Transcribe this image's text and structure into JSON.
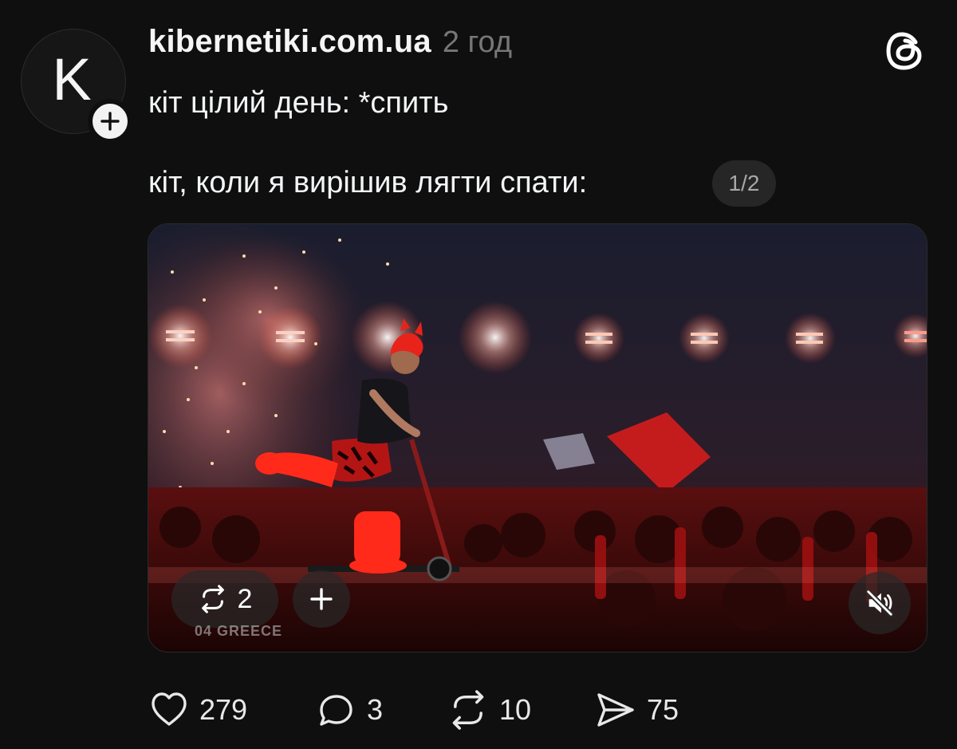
{
  "author": {
    "avatar_letter": "K",
    "username": "kibernetiki.com.ua",
    "time_ago": "2 год"
  },
  "post": {
    "line1": "кіт цілий день: *спить",
    "line2": "кіт, коли я вирішив лягти спати:",
    "page_indicator": "1/2"
  },
  "media": {
    "repost_count": "2",
    "watermark": "04 GREECE",
    "muted": true
  },
  "actions": {
    "likes": "279",
    "comments": "3",
    "reposts": "10",
    "shares": "75"
  },
  "icons": {
    "follow": "plus-icon",
    "app": "threads-logo-icon",
    "repost": "repost-icon",
    "add": "plus-icon",
    "mute": "speaker-muted-icon",
    "like": "heart-icon",
    "comment": "comment-icon",
    "share": "send-icon"
  },
  "colors": {
    "background": "#0f0f0f",
    "text": "#f3f5f7",
    "muted_text": "#777777"
  }
}
